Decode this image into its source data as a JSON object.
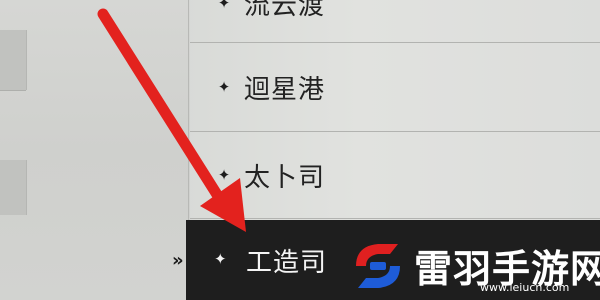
{
  "menu": {
    "items": [
      {
        "label": "流云渡",
        "marker": "✦"
      },
      {
        "label": "迴星港",
        "marker": "✦"
      },
      {
        "label": "太卜司",
        "marker": "✦"
      }
    ],
    "selected": {
      "label": "工造司",
      "marker": "✦",
      "indicator": "»"
    }
  },
  "watermark": {
    "brand": "雷羽手游网",
    "url": "www.leiucn.com",
    "colors": {
      "red": "#e02020",
      "blue": "#1e5cd8"
    }
  },
  "annotation": {
    "color": "#e3221e"
  }
}
